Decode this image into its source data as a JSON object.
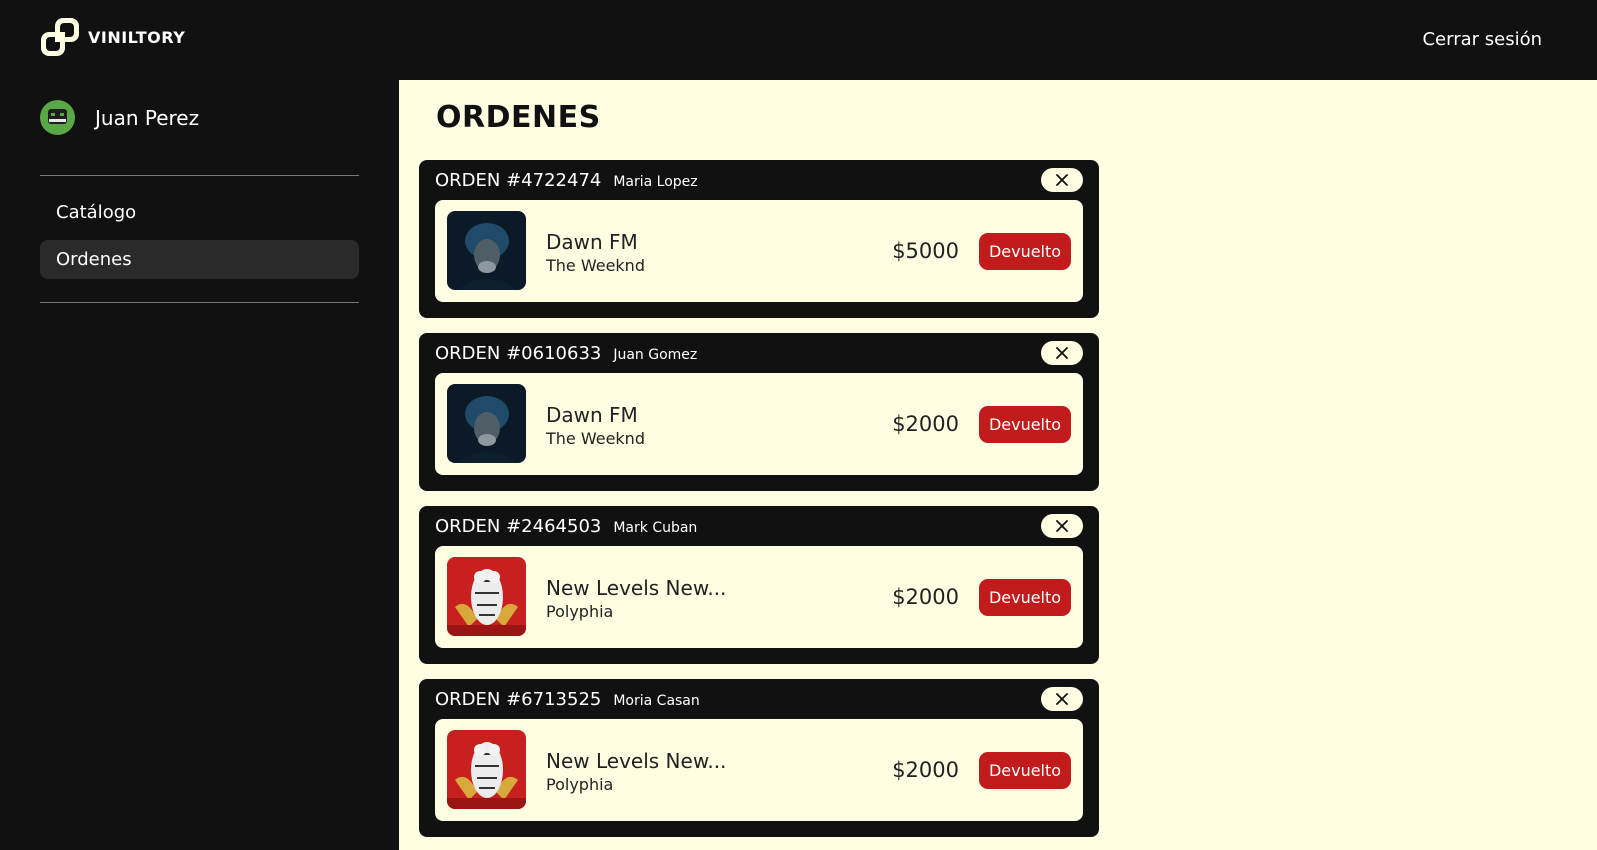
{
  "app": {
    "name": "VINILTORY"
  },
  "header": {
    "logout_label": "Cerrar sesión"
  },
  "user": {
    "name": "Juan Perez"
  },
  "sidebar": {
    "items": [
      {
        "label": "Catálogo",
        "active": false
      },
      {
        "label": "Ordenes",
        "active": true
      }
    ]
  },
  "page": {
    "title": "ORDENES"
  },
  "orders": [
    {
      "number": "ORDEN #4722474",
      "client": "Maria Lopez",
      "album": "Dawn FM",
      "artist": "The Weeknd",
      "price": "$5000",
      "status": "Devuelto",
      "cover": "dawn-fm-cover"
    },
    {
      "number": "ORDEN #0610633",
      "client": "Juan Gomez",
      "album": "Dawn FM",
      "artist": "The Weeknd",
      "price": "$2000",
      "status": "Devuelto",
      "cover": "dawn-fm-cover"
    },
    {
      "number": "ORDEN #2464503",
      "client": "Mark Cuban",
      "album": "New Levels New...",
      "artist": "Polyphia",
      "price": "$2000",
      "status": "Devuelto",
      "cover": "new-levels-cover"
    },
    {
      "number": "ORDEN #6713525",
      "client": "Moria Casan",
      "album": "New Levels New...",
      "artist": "Polyphia",
      "price": "$2000",
      "status": "Devuelto",
      "cover": "new-levels-cover"
    }
  ],
  "colors": {
    "background": "#111111",
    "panel": "#fffee3",
    "status": "#c21b1b",
    "avatar": "#5aa845"
  }
}
